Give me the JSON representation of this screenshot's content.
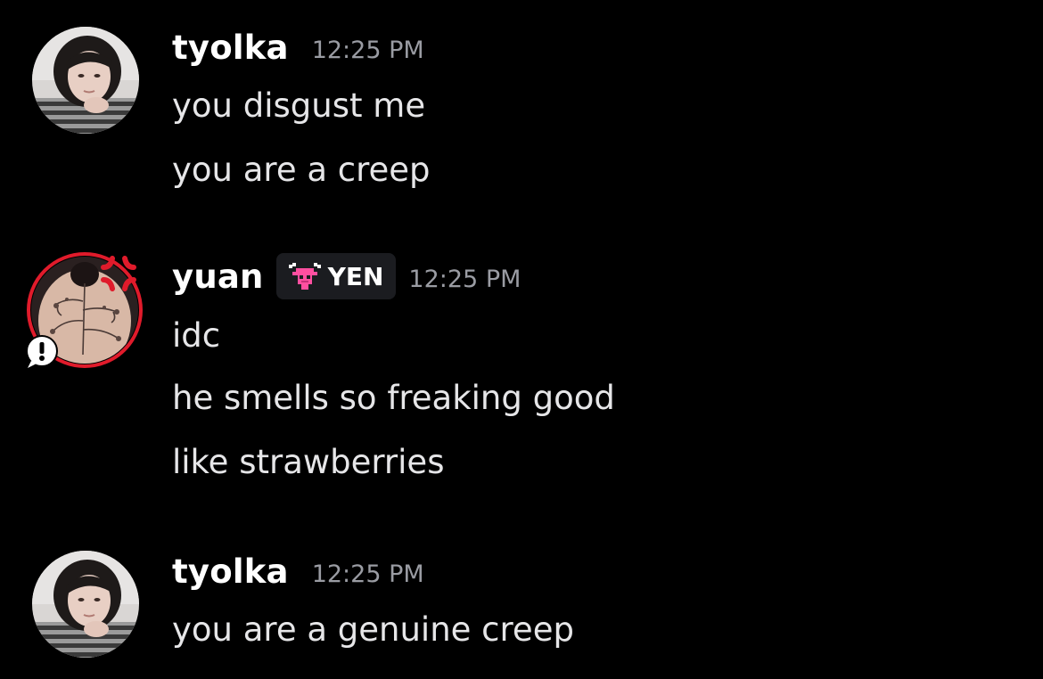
{
  "messages": [
    {
      "username": "tyolka",
      "timestamp": "12:25 PM",
      "avatar_icon": "girl-portrait-avatar",
      "lines": [
        "you disgust me",
        "you are a creep"
      ]
    },
    {
      "username": "yuan",
      "badge": {
        "icon": "pixel-goat-icon",
        "label": "YEN",
        "icon_color": "#ff4fa0"
      },
      "timestamp": "12:25 PM",
      "avatar_icon": "tattooed-back-avatar",
      "avatar_decoration": "anger-symbol-icon",
      "status_icon": "exclamation-speech-bubble-icon",
      "ring_color": "#e01b2b",
      "lines": [
        "idc",
        "he smells so freaking good",
        "like strawberries"
      ]
    },
    {
      "username": "tyolka",
      "timestamp": "12:25 PM",
      "avatar_icon": "girl-portrait-avatar",
      "lines": [
        "you are a genuine creep"
      ]
    }
  ],
  "colors": {
    "background": "#000000",
    "username": "#ffffff",
    "message_text": "#e6e6e8",
    "timestamp": "#9a9ca3",
    "badge_bg": "#1b1c20"
  }
}
